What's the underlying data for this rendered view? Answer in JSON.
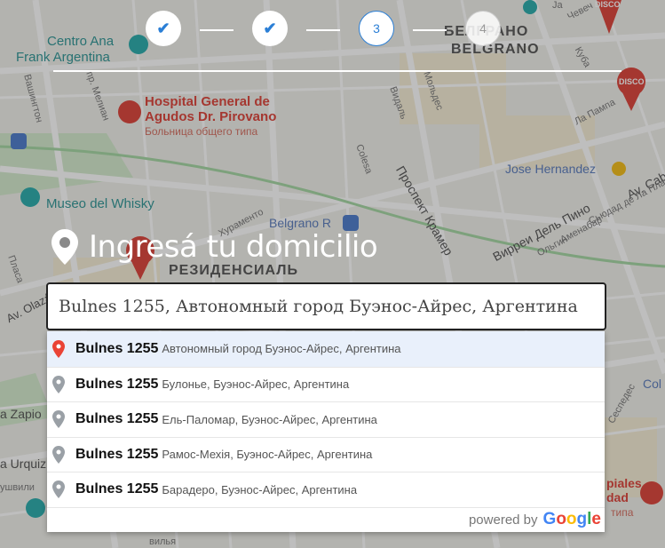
{
  "stepper": {
    "steps": [
      {
        "label": "✔",
        "state": "done"
      },
      {
        "label": "✔",
        "state": "done"
      },
      {
        "label": "3",
        "state": "active"
      },
      {
        "label": "4",
        "state": "pending"
      }
    ]
  },
  "heading": {
    "icon": "map-pin-icon",
    "title": "Ingresá tu domicilio"
  },
  "search": {
    "value": "Bulnes 1255, Автономный город Буэнос-Айрес, Аргентина"
  },
  "suggestions": [
    {
      "main": "Bulnes 1255",
      "secondary": "Автономный город Буэнос-Айрес, Аргентина",
      "marker_color": "#ea4335"
    },
    {
      "main": "Bulnes 1255",
      "secondary": "Булонье, Буэнос-Айрес, Аргентина",
      "marker_color": "#9aa0a6"
    },
    {
      "main": "Bulnes 1255",
      "secondary": "Ель-Паломар, Буэнос-Айрес, Аргентина",
      "marker_color": "#9aa0a6"
    },
    {
      "main": "Bulnes 1255",
      "secondary": "Рамос-Мехія, Буэнос-Айрес, Аргентина",
      "marker_color": "#9aa0a6"
    },
    {
      "main": "Bulnes 1255",
      "secondary": "Барадеро, Буэнос-Айрес, Аргентина",
      "marker_color": "#9aa0a6"
    }
  ],
  "powered_by": {
    "text": "powered by",
    "brand": "Google"
  },
  "map": {
    "labels": {
      "centro_ana": "Centro Ana",
      "frank": "Frank Argentina",
      "hospital_1": "Hospital General de",
      "hospital_2": "Agudos Dr. Pirovano",
      "hospital_ru": "Больница общего типа",
      "museo": "Museo del Whisky",
      "belgrano_r": "Belgrano R",
      "belgrano_ru": "БЕЛГРАНО",
      "belgrano": "BELGRANO",
      "residencial": "РЕЗИДЕНСИАЛЬ",
      "jose": "Jose Hernandez",
      "prospekt": "Проспект Крамер",
      "virrey": "Вирреи Дель Пино",
      "av_cab": "Av. Cab",
      "la_pampa": "Ла Пампа",
      "av_olaz": "Av. Olazábal",
      "vashington": "Вашингтон",
      "melian": "пр. Мелиан",
      "vidal": "Видаль",
      "moldes": "Мольдес",
      "solesa": "Сolesa",
      "khuramento": "Хураменто",
      "amenabar": "Аменабар",
      "sucre": "Сьюдад де Ла Плата",
      "plasa": "Пласа",
      "zapio": "a Zapio",
      "urquiz": "a Urquiz",
      "ushvili": "ушвили",
      "col": "Col",
      "disco": "DISCO",
      "sespedes": "Сеспедес",
      "olgin": "Ольгин",
      "kuba": "Куба",
      "ja": "Ja",
      "chevech": "Чевеч",
      "piales": "piales",
      "dad": "dad",
      "tipa": "типа",
      "villa": "вилья"
    }
  }
}
